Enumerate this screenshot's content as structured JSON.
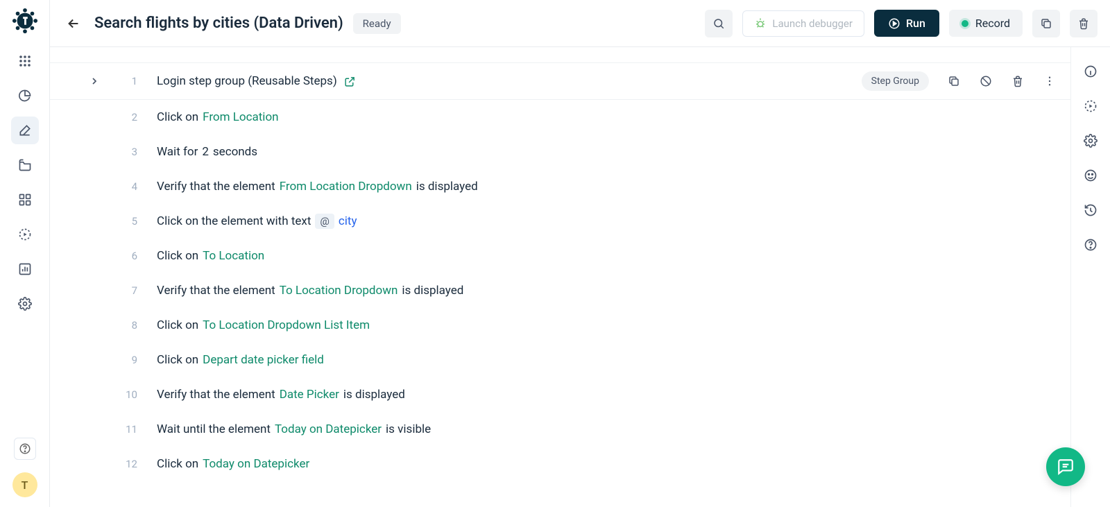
{
  "header": {
    "title": "Search flights by cities (Data Driven)",
    "status": "Ready",
    "launch_debugger": "Launch debugger",
    "run": "Run",
    "record": "Record"
  },
  "sidebar": {
    "avatar_initial": "T"
  },
  "steps": [
    {
      "num": "1",
      "group": true,
      "parts": [
        {
          "type": "text",
          "value": "Login step group (Reusable Steps)"
        },
        {
          "type": "external"
        }
      ],
      "badge": "Step Group"
    },
    {
      "num": "2",
      "parts": [
        {
          "type": "text",
          "value": "Click on"
        },
        {
          "type": "link",
          "value": "From Location"
        }
      ]
    },
    {
      "num": "3",
      "parts": [
        {
          "type": "text",
          "value": "Wait for"
        },
        {
          "type": "val",
          "value": "2"
        },
        {
          "type": "text",
          "value": "seconds"
        }
      ]
    },
    {
      "num": "4",
      "parts": [
        {
          "type": "text",
          "value": "Verify that the element"
        },
        {
          "type": "link",
          "value": "From Location Dropdown"
        },
        {
          "type": "text",
          "value": "is displayed"
        }
      ]
    },
    {
      "num": "5",
      "parts": [
        {
          "type": "text",
          "value": "Click on the element with text"
        },
        {
          "type": "at",
          "value": "@"
        },
        {
          "type": "blue",
          "value": "city"
        }
      ]
    },
    {
      "num": "6",
      "parts": [
        {
          "type": "text",
          "value": "Click on"
        },
        {
          "type": "link",
          "value": "To Location"
        }
      ]
    },
    {
      "num": "7",
      "parts": [
        {
          "type": "text",
          "value": "Verify that the element"
        },
        {
          "type": "link",
          "value": "To Location Dropdown"
        },
        {
          "type": "text",
          "value": "is displayed"
        }
      ]
    },
    {
      "num": "8",
      "parts": [
        {
          "type": "text",
          "value": "Click on"
        },
        {
          "type": "link",
          "value": "To Location Dropdown List Item"
        }
      ]
    },
    {
      "num": "9",
      "parts": [
        {
          "type": "text",
          "value": "Click on"
        },
        {
          "type": "link",
          "value": "Depart date picker field"
        }
      ]
    },
    {
      "num": "10",
      "parts": [
        {
          "type": "text",
          "value": "Verify that the element"
        },
        {
          "type": "link",
          "value": "Date Picker"
        },
        {
          "type": "text",
          "value": "is displayed"
        }
      ]
    },
    {
      "num": "11",
      "parts": [
        {
          "type": "text",
          "value": "Wait until the element"
        },
        {
          "type": "link",
          "value": "Today on Datepicker"
        },
        {
          "type": "text",
          "value": "is visible"
        }
      ]
    },
    {
      "num": "12",
      "parts": [
        {
          "type": "text",
          "value": "Click on"
        },
        {
          "type": "link",
          "value": "Today on Datepicker"
        }
      ]
    }
  ]
}
